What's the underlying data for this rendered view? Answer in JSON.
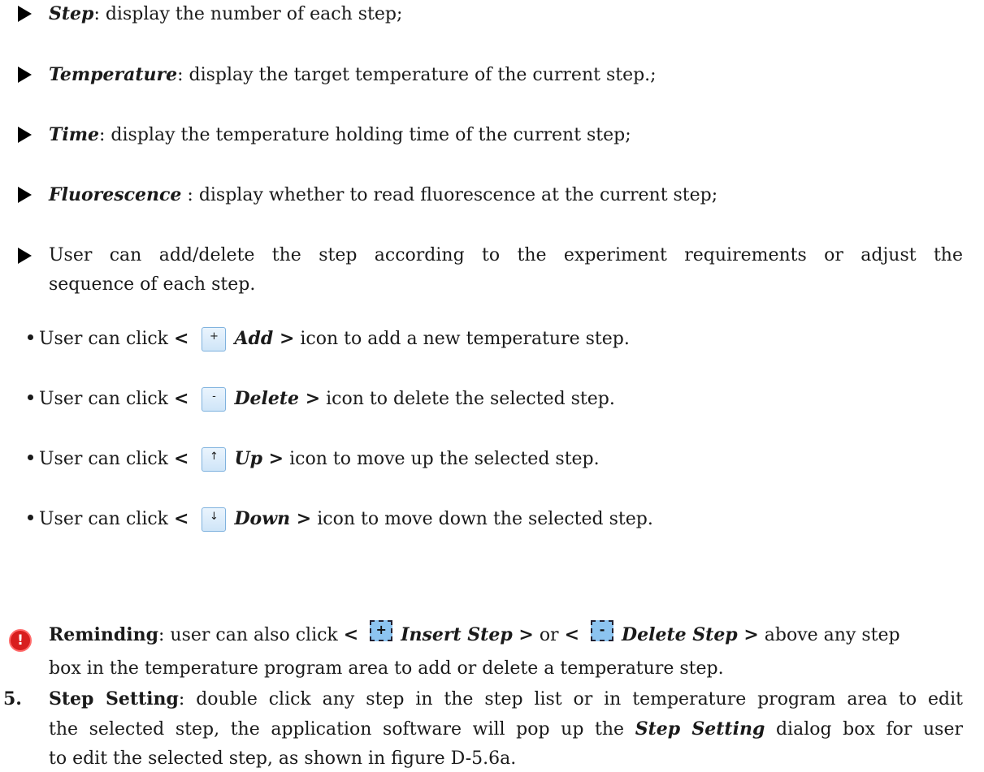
{
  "bullets": [
    {
      "term": "Step",
      "sep": ": ",
      "text": "display the number of each step;"
    },
    {
      "term": "Temperature",
      "sep": ": ",
      "text": "display the target temperature of the current step.;"
    },
    {
      "term": "Time",
      "sep": ": ",
      "text": "display the temperature holding time of the current step;"
    },
    {
      "term": "Fluorescence",
      "sep": " :  ",
      "text": "display whether to read fluorescence at the current step;"
    }
  ],
  "user_bullet": {
    "line1": "User can add/delete the step according to the experiment requirements or adjust the",
    "line2": "sequence of each step."
  },
  "icon_items": [
    {
      "prefix": "User can click",
      "lt": "<",
      "glyph": "+",
      "action": "Add >",
      "suffix": "icon to add a new temperature step."
    },
    {
      "prefix": "User can click",
      "lt": "<",
      "glyph": "-",
      "action": "Delete >",
      "suffix": "icon to delete the selected step."
    },
    {
      "prefix": "User can click",
      "lt": "<",
      "glyph": "↑",
      "action": "Up >",
      "suffix": "icon to move up the selected step."
    },
    {
      "prefix": "User can click",
      "lt": "<",
      "glyph": "↓",
      "action": "Down >",
      "suffix": "icon to move down the selected step."
    }
  ],
  "reminder": {
    "icon": "alert-icon",
    "label": "Reminding",
    "text1": ": user can also click",
    "lt1": "<",
    "glyph1": "+",
    "action1": "Insert Step >",
    "or": "or",
    "lt2": "<",
    "glyph2": "-",
    "action2": "Delete Step >",
    "text2": "above any step",
    "line2": "box in the temperature program area to add or delete a temperature step."
  },
  "step_setting": {
    "number": "5.",
    "title": "Step Setting",
    "line1": ": double click any step in the step list or in temperature program area to edit",
    "line2_a": "the selected step, the application software will pop up the",
    "line2_b": "Step Setting",
    "line2_c": "dialog box for user",
    "line3": "to edit the selected step, as shown in figure D-5.6a."
  },
  "colors": {
    "icon_fill": "#cfe5f8",
    "icon_border": "#7fb2de",
    "dashed_icon_fill": "#8cc4f0",
    "alert_red": "#d81e1e"
  }
}
